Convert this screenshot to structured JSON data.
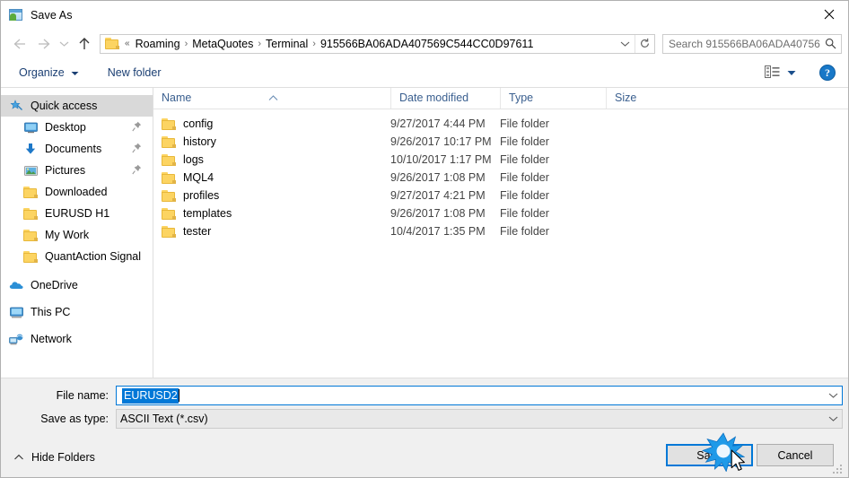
{
  "window": {
    "title": "Save As",
    "icon": "save-as-app-icon",
    "close_label": "✕"
  },
  "nav": {
    "back_icon": "arrow-left-icon",
    "forward_icon": "arrow-right-icon",
    "recent_icon": "chevron-down-icon",
    "up_icon": "arrow-up-icon",
    "refresh_icon": "refresh-icon",
    "dropdown_icon": "chevron-down-icon",
    "breadcrumb_prefix": "«",
    "breadcrumbs": [
      "Roaming",
      "MetaQuotes",
      "Terminal",
      "915566BA06ADA407569C544CC0D97611"
    ],
    "separator": "›"
  },
  "search": {
    "placeholder": "Search 915566BA06ADA40756...",
    "icon": "search-icon"
  },
  "toolbar": {
    "organize_label": "Organize",
    "organize_caret": "▾",
    "new_folder_label": "New folder",
    "view_icon": "view-layout-icon",
    "view_caret": "▾",
    "help_label": "?",
    "help_icon": "help-icon"
  },
  "sidebar": {
    "items": [
      {
        "label": "Quick access",
        "icon": "star-pin-icon",
        "selected": true,
        "indent": false,
        "pinned": false
      },
      {
        "label": "Desktop",
        "icon": "desktop-icon",
        "selected": false,
        "indent": true,
        "pinned": true
      },
      {
        "label": "Documents",
        "icon": "documents-download-icon",
        "selected": false,
        "indent": true,
        "pinned": true
      },
      {
        "label": "Pictures",
        "icon": "pictures-icon",
        "selected": false,
        "indent": true,
        "pinned": true
      },
      {
        "label": "Downloaded",
        "icon": "folder-icon",
        "selected": false,
        "indent": true,
        "pinned": false
      },
      {
        "label": "EURUSD H1",
        "icon": "folder-icon",
        "selected": false,
        "indent": true,
        "pinned": false
      },
      {
        "label": "My Work",
        "icon": "folder-icon",
        "selected": false,
        "indent": true,
        "pinned": false
      },
      {
        "label": "QuantAction Signal",
        "icon": "folder-icon",
        "selected": false,
        "indent": true,
        "pinned": false
      },
      {
        "label": "OneDrive",
        "icon": "onedrive-icon",
        "selected": false,
        "indent": false,
        "pinned": false
      },
      {
        "label": "This PC",
        "icon": "this-pc-icon",
        "selected": false,
        "indent": false,
        "pinned": false
      },
      {
        "label": "Network",
        "icon": "network-icon",
        "selected": false,
        "indent": false,
        "pinned": false
      }
    ]
  },
  "filelist": {
    "columns": [
      "Name",
      "Date modified",
      "Type",
      "Size"
    ],
    "sort_column": "Name",
    "sort_caret": "∧",
    "rows": [
      {
        "name": "config",
        "date": "9/27/2017 4:44 PM",
        "type": "File folder",
        "size": ""
      },
      {
        "name": "history",
        "date": "9/26/2017 10:17 PM",
        "type": "File folder",
        "size": ""
      },
      {
        "name": "logs",
        "date": "10/10/2017 1:17 PM",
        "type": "File folder",
        "size": ""
      },
      {
        "name": "MQL4",
        "date": "9/26/2017 1:08 PM",
        "type": "File folder",
        "size": ""
      },
      {
        "name": "profiles",
        "date": "9/27/2017 4:21 PM",
        "type": "File folder",
        "size": ""
      },
      {
        "name": "templates",
        "date": "9/26/2017 1:08 PM",
        "type": "File folder",
        "size": ""
      },
      {
        "name": "tester",
        "date": "10/4/2017 1:35 PM",
        "type": "File folder",
        "size": ""
      }
    ]
  },
  "form": {
    "filename_label": "File name:",
    "filename_value": "EURUSD2",
    "filetype_label": "Save as type:",
    "filetype_value": "ASCII Text (*.csv)",
    "combo_arrow": "⌵"
  },
  "footer": {
    "hide_folders_label": "Hide Folders",
    "hide_folders_caret": "∧",
    "save_label": "Save",
    "cancel_label": "Cancel"
  },
  "colors": {
    "accent": "#0078d7",
    "folder_yellow": "#fcd462",
    "command_text": "#1b3f73",
    "column_header": "#3a5f8f",
    "footer_bg": "#f0f0f0",
    "selection_bg": "#0078d7",
    "sidebar_selected": "#d9d9d9"
  }
}
